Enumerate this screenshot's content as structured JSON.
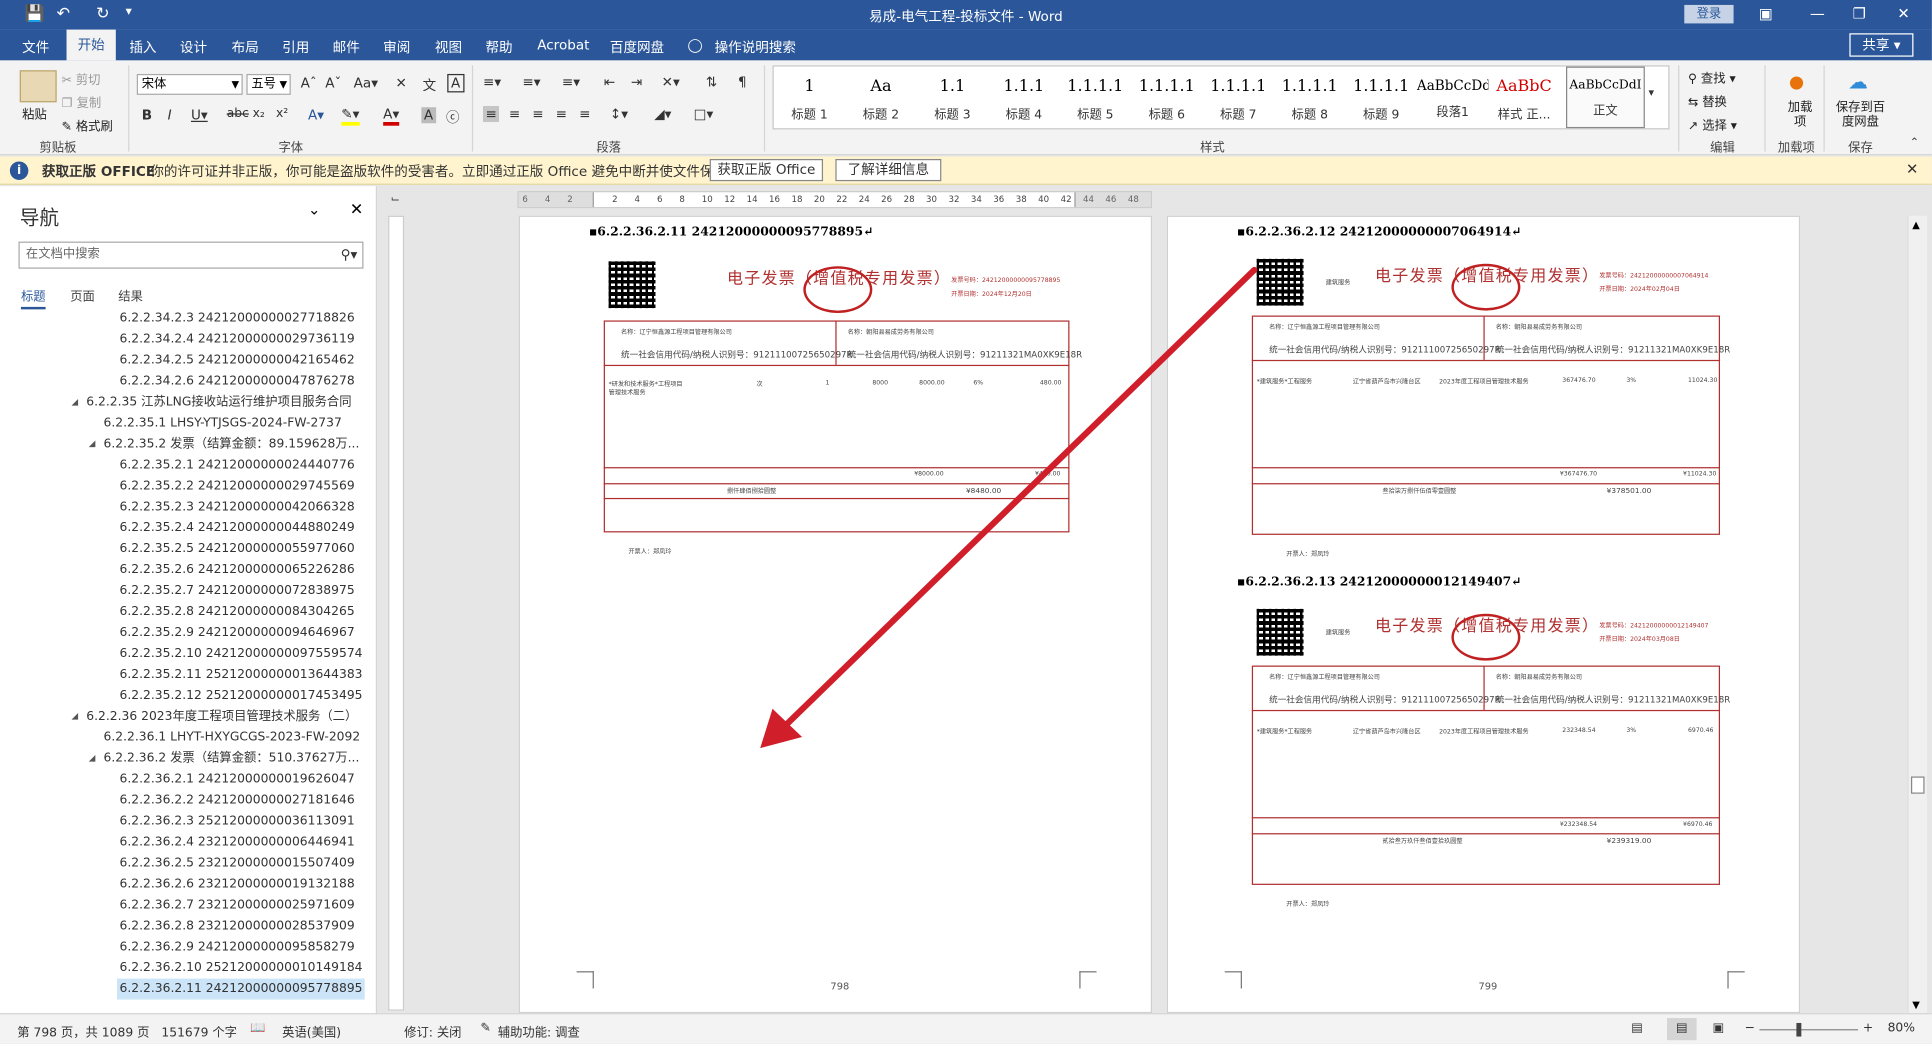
{
  "window": {
    "title": "易成-电气工程-投标文件 - Word",
    "login": "登录"
  },
  "menu": {
    "tabs": [
      "文件",
      "开始",
      "插入",
      "设计",
      "布局",
      "引用",
      "邮件",
      "审阅",
      "视图",
      "帮助",
      "Acrobat",
      "百度网盘"
    ],
    "tell_me": "操作说明搜索",
    "share": "共享"
  },
  "ribbon": {
    "clipboard": {
      "label": "剪贴板",
      "paste": "粘贴",
      "cut": "剪切",
      "copy": "复制",
      "format_painter": "格式刷"
    },
    "font": {
      "label": "字体",
      "name": "宋体",
      "size": "五号"
    },
    "paragraph": {
      "label": "段落"
    },
    "styles": {
      "label": "样式",
      "items": [
        {
          "preview": "1",
          "name": "标题 1"
        },
        {
          "preview": "Aa",
          "name": "标题 2"
        },
        {
          "preview": "1.1",
          "name": "标题 3"
        },
        {
          "preview": "1.1.1",
          "name": "标题 4"
        },
        {
          "preview": "1.1.1.1",
          "name": "标题 5"
        },
        {
          "preview": "1.1.1.1",
          "name": "标题 6"
        },
        {
          "preview": "1.1.1.1",
          "name": "标题 7"
        },
        {
          "preview": "1.1.1.1",
          "name": "标题 8"
        },
        {
          "preview": "1.1.1.1",
          "name": "标题 9"
        },
        {
          "preview": "AaBbCcDd",
          "name": "段落1"
        },
        {
          "preview": "AaBbC",
          "name": "样式 正..."
        },
        {
          "preview": "AaBbCcDdI",
          "name": "正文"
        }
      ]
    },
    "editing": {
      "label": "编辑",
      "find": "查找",
      "replace": "替换",
      "select": "选择"
    },
    "addins": {
      "label": "加载项",
      "btn": "加载项"
    },
    "save": {
      "label": "保存",
      "btn": "保存到百度网盘"
    }
  },
  "infobar": {
    "title": "获取正版 OFFICE",
    "message": "你的许可证并非正版，你可能是盗版软件的受害者。立即通过正版 Office 避免中断并使文件保持安全。",
    "btn1": "获取正版 Office",
    "btn2": "了解详细信息"
  },
  "nav": {
    "title": "导航",
    "search_placeholder": "在文档中搜索",
    "tabs": [
      "标题",
      "页面",
      "结果"
    ],
    "items": [
      {
        "text": "6.2.2.34.2.3 24212000000027718826",
        "level": 3
      },
      {
        "text": "6.2.2.34.2.4 24212000000029736119",
        "level": 3
      },
      {
        "text": "6.2.2.34.2.5 24212000000042165462",
        "level": 3
      },
      {
        "text": "6.2.2.34.2.6 24212000000047876278",
        "level": 3
      },
      {
        "text": "6.2.2.35 江苏LNG接收站运行维护项目服务合同",
        "level": 1,
        "expand": true
      },
      {
        "text": "6.2.2.35.1 LHSY-YTJSGS-2024-FW-2737",
        "level": 2
      },
      {
        "text": "6.2.2.35.2 发票（结算金额：89.159628万...",
        "level": 2,
        "expand": true
      },
      {
        "text": "6.2.2.35.2.1 24212000000024440776",
        "level": 3
      },
      {
        "text": "6.2.2.35.2.2 24212000000029745569",
        "level": 3
      },
      {
        "text": "6.2.2.35.2.3 24212000000042066328",
        "level": 3
      },
      {
        "text": "6.2.2.35.2.4 24212000000044880249",
        "level": 3
      },
      {
        "text": "6.2.2.35.2.5 24212000000055977060",
        "level": 3
      },
      {
        "text": "6.2.2.35.2.6 24212000000065226286",
        "level": 3
      },
      {
        "text": "6.2.2.35.2.7 24212000000072838975",
        "level": 3
      },
      {
        "text": "6.2.2.35.2.8 24212000000084304265",
        "level": 3
      },
      {
        "text": "6.2.2.35.2.9 24212000000094646967",
        "level": 3
      },
      {
        "text": "6.2.2.35.2.10 24212000000097559574",
        "level": 3
      },
      {
        "text": "6.2.2.35.2.11 25212000000013644383",
        "level": 3
      },
      {
        "text": "6.2.2.35.2.12 25212000000017453495",
        "level": 3
      },
      {
        "text": "6.2.2.36 2023年度工程项目管理技术服务（二）",
        "level": 1,
        "expand": true
      },
      {
        "text": "6.2.2.36.1 LHYT-HXYGCGS-2023-FW-2092",
        "level": 2
      },
      {
        "text": "6.2.2.36.2 发票（结算金额：510.37627万...",
        "level": 2,
        "expand": true
      },
      {
        "text": "6.2.2.36.2.1 24212000000019626047",
        "level": 3
      },
      {
        "text": "6.2.2.36.2.2 24212000000027181646",
        "level": 3
      },
      {
        "text": "6.2.2.36.2.3 25212000000036113091",
        "level": 3
      },
      {
        "text": "6.2.2.36.2.4 23212000000006446941",
        "level": 3
      },
      {
        "text": "6.2.2.36.2.5 23212000000015507409",
        "level": 3
      },
      {
        "text": "6.2.2.36.2.6 23212000000019132188",
        "level": 3
      },
      {
        "text": "6.2.2.36.2.7 23212000000025971609",
        "level": 3
      },
      {
        "text": "6.2.2.36.2.8 23212000000028537909",
        "level": 3
      },
      {
        "text": "6.2.2.36.2.9 24212000000095858279",
        "level": 3
      },
      {
        "text": "6.2.2.36.2.10 25212000000010149184",
        "level": 3
      },
      {
        "text": "6.2.2.36.2.11 24212000000095778895",
        "level": 3,
        "selected": true
      }
    ]
  },
  "ruler": {
    "ticks": [
      "6",
      "4",
      "2",
      "",
      "2",
      "4",
      "6",
      "8",
      "10",
      "12",
      "14",
      "16",
      "18",
      "20",
      "22",
      "24",
      "26",
      "28",
      "30",
      "32",
      "34",
      "36",
      "38",
      "40",
      "42",
      "44",
      "46",
      "48"
    ]
  },
  "pages": {
    "left": {
      "heading": "6.2.2.36.2.11 24212000000095778895",
      "page_number": "798",
      "invoice": {
        "title": "电子发票（增值税专用发票）",
        "number": "发票号码：24212000000095778895",
        "date": "开票日期：2024年12月20日",
        "buyer": "名称：辽宁恒鑫源工程项目管理有限公司",
        "buyer_id": "统一社会信用代码/纳税人识别号：91211100725650297R",
        "seller": "名称：朝阳县易成劳务有限公司",
        "seller_id": "统一社会信用代码/纳税人识别号：91211321MA0XK9E18R",
        "item": "*研发和技术服务*工程项目管理技术服务",
        "unit": "次",
        "qty": "1",
        "price": "8000",
        "amount": "8000.00",
        "rate": "6%",
        "tax": "480.00",
        "total_amount": "¥8000.00",
        "total_tax": "¥480.00",
        "total_words": "捌仟肆佰捌拾圆整",
        "total": "¥8480.00",
        "issuer": "开票人：郑凤玲"
      }
    },
    "right": {
      "heading1": "6.2.2.36.2.12 24212000000007064914",
      "heading2": "6.2.2.36.2.13 24212000000012149407",
      "page_number": "799",
      "invoice1": {
        "title": "电子发票（增值税专用发票）",
        "category": "建筑服务",
        "number": "发票号码：24212000000007064914",
        "date": "开票日期：2024年02月04日",
        "buyer": "名称：辽宁恒鑫源工程项目管理有限公司",
        "buyer_id": "统一社会信用代码/纳税人识别号：91211100725650297R",
        "seller": "名称：朝阳县易成劳务有限公司",
        "seller_id": "统一社会信用代码/纳税人识别号：91211321MA0XK9E18R",
        "item": "*建筑服务*工程服务",
        "location": "辽宁省葫芦岛市兴隆台区",
        "project": "2023年度工程项目管理技术服务",
        "amount": "367476.70",
        "rate": "3%",
        "tax": "11024.30",
        "total_amount": "¥367476.70",
        "total_tax": "¥11024.30",
        "total_words": "叁拾柒万捌仟伍佰零壹圆整",
        "total": "¥378501.00",
        "issuer": "开票人：郑凤玲"
      },
      "invoice2": {
        "title": "电子发票（增值税专用发票）",
        "category": "建筑服务",
        "number": "发票号码：24212000000012149407",
        "date": "开票日期：2024年03月08日",
        "buyer": "名称：辽宁恒鑫源工程项目管理有限公司",
        "buyer_id": "统一社会信用代码/纳税人识别号：91211100725650297R",
        "seller": "名称：朝阳县易成劳务有限公司",
        "seller_id": "统一社会信用代码/纳税人识别号：91211321MA0XK9E18R",
        "item": "*建筑服务*工程服务",
        "location": "辽宁省葫芦岛市兴隆台区",
        "project": "2023年度工程项目管理技术服务",
        "amount": "232348.54",
        "rate": "3%",
        "tax": "6970.46",
        "total_amount": "¥232348.54",
        "total_tax": "¥6970.46",
        "total_words": "贰拾叁万玖仟叁佰壹拾玖圆整",
        "total": "¥239319.00",
        "issuer": "开票人：郑凤玲"
      }
    }
  },
  "status": {
    "page": "第 798 页，共 1089 页",
    "words": "151679 个字",
    "lang": "英语(美国)",
    "track": "修订: 关闭",
    "access": "辅助功能: 调查",
    "zoom": "80%"
  },
  "colors": {
    "brand": "#2b579a",
    "invoice_red": "#b03030",
    "arrow": "#d01f2a"
  }
}
